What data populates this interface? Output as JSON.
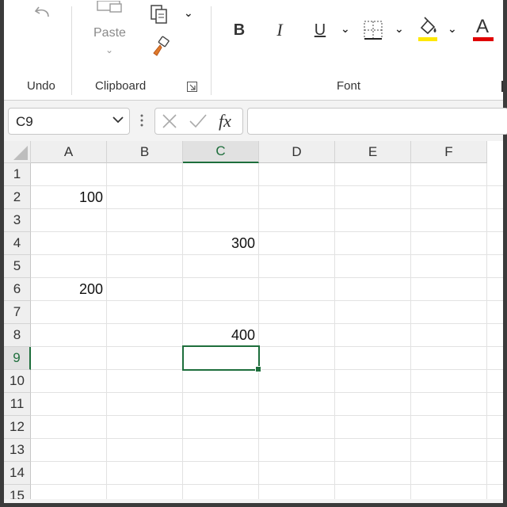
{
  "ribbon": {
    "groups": {
      "undo": "Undo",
      "clipboard": "Clipboard",
      "font": "Font"
    },
    "paste_label": "Paste",
    "font_buttons": {
      "bold": "B",
      "italic": "I",
      "underline": "U",
      "font_color": "A"
    },
    "colors": {
      "highlight": "#ffe800",
      "font_color": "#e00000"
    }
  },
  "formula_bar": {
    "name_box": "C9",
    "formula": ""
  },
  "sheet": {
    "columns": [
      "A",
      "B",
      "C",
      "D",
      "E",
      "F"
    ],
    "rows": [
      "1",
      "2",
      "3",
      "4",
      "5",
      "6",
      "7",
      "8",
      "9",
      "10",
      "11",
      "12",
      "13",
      "14",
      "15"
    ],
    "active_cell": "C9",
    "cells": {
      "A2": "100",
      "C4": "300",
      "A6": "200",
      "C8": "400"
    }
  },
  "theme": {
    "accent": "#1e6e3c"
  }
}
